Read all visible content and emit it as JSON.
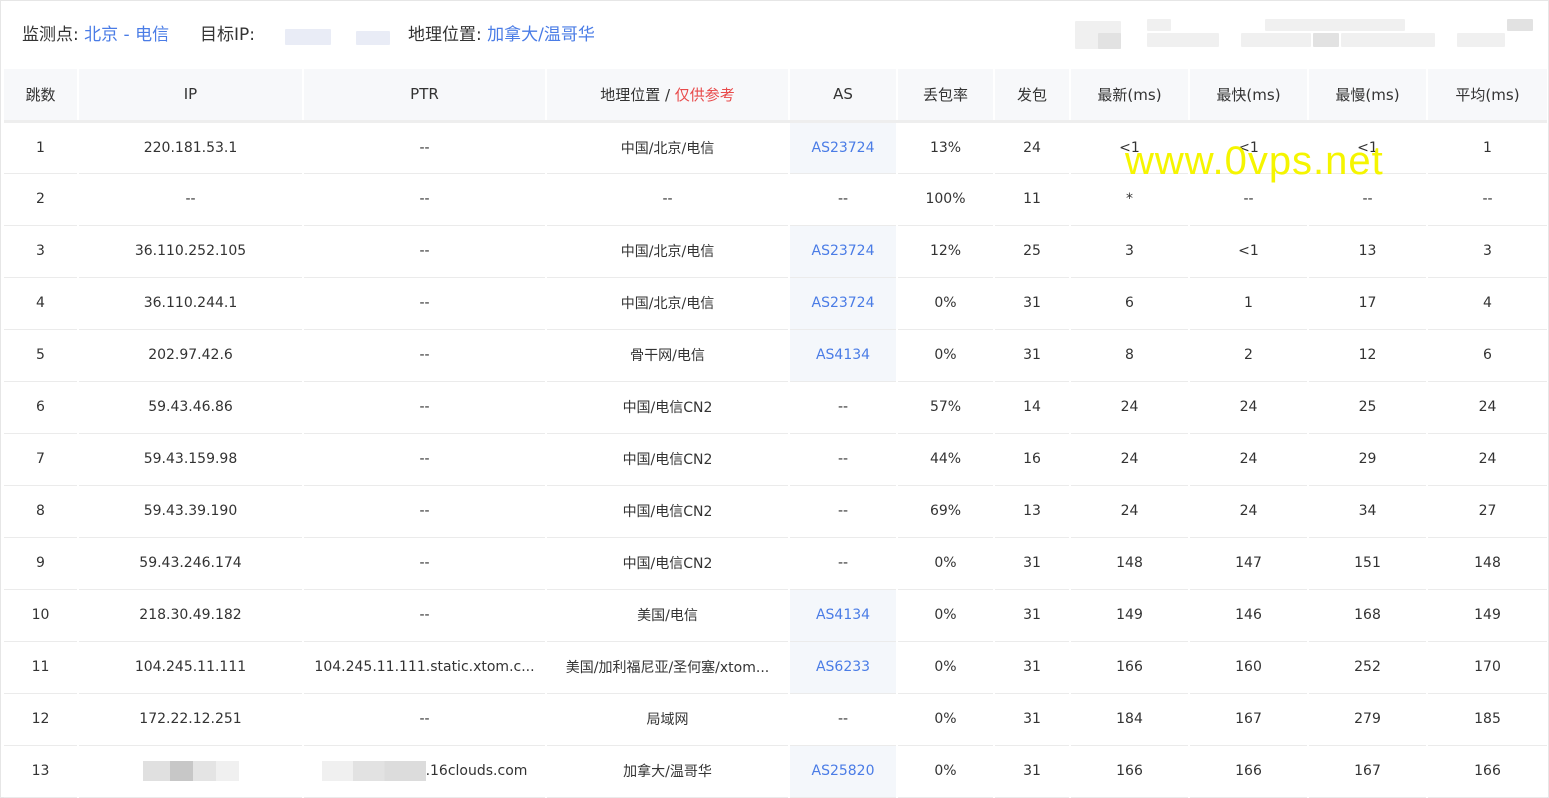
{
  "header": {
    "monitor_label": "监测点:",
    "monitor_value": "北京 - 电信",
    "target_label": "目标IP:",
    "geo_label": "地理位置:",
    "geo_value": "加拿大/温哥华"
  },
  "table": {
    "columns": [
      "跳数",
      "IP",
      "PTR",
      "地理位置",
      "AS",
      "丢包率",
      "发包",
      "最新(ms)",
      "最快(ms)",
      "最慢(ms)",
      "平均(ms)"
    ],
    "geo_sep": " / ",
    "geo_note": "仅供参考",
    "rows": [
      {
        "hop": "1",
        "ip": "220.181.53.1",
        "ptr": "--",
        "geo": "中国/北京/电信",
        "as": "AS23724",
        "loss": "13%",
        "sent": "24",
        "last": "<1",
        "best": "<1",
        "worst": "<1",
        "avg": "1"
      },
      {
        "hop": "2",
        "ip": "--",
        "ptr": "--",
        "geo": "--",
        "as": "--",
        "loss": "100%",
        "sent": "11",
        "last": "*",
        "best": "--",
        "worst": "--",
        "avg": "--"
      },
      {
        "hop": "3",
        "ip": "36.110.252.105",
        "ptr": "--",
        "geo": "中国/北京/电信",
        "as": "AS23724",
        "loss": "12%",
        "sent": "25",
        "last": "3",
        "best": "<1",
        "worst": "13",
        "avg": "3"
      },
      {
        "hop": "4",
        "ip": "36.110.244.1",
        "ptr": "--",
        "geo": "中国/北京/电信",
        "as": "AS23724",
        "loss": "0%",
        "sent": "31",
        "last": "6",
        "best": "1",
        "worst": "17",
        "avg": "4"
      },
      {
        "hop": "5",
        "ip": "202.97.42.6",
        "ptr": "--",
        "geo": "骨干网/电信",
        "as": "AS4134",
        "loss": "0%",
        "sent": "31",
        "last": "8",
        "best": "2",
        "worst": "12",
        "avg": "6"
      },
      {
        "hop": "6",
        "ip": "59.43.46.86",
        "ptr": "--",
        "geo": "中国/电信CN2",
        "as": "--",
        "loss": "57%",
        "sent": "14",
        "last": "24",
        "best": "24",
        "worst": "25",
        "avg": "24"
      },
      {
        "hop": "7",
        "ip": "59.43.159.98",
        "ptr": "--",
        "geo": "中国/电信CN2",
        "as": "--",
        "loss": "44%",
        "sent": "16",
        "last": "24",
        "best": "24",
        "worst": "29",
        "avg": "24"
      },
      {
        "hop": "8",
        "ip": "59.43.39.190",
        "ptr": "--",
        "geo": "中国/电信CN2",
        "as": "--",
        "loss": "69%",
        "sent": "13",
        "last": "24",
        "best": "24",
        "worst": "34",
        "avg": "27"
      },
      {
        "hop": "9",
        "ip": "59.43.246.174",
        "ptr": "--",
        "geo": "中国/电信CN2",
        "as": "--",
        "loss": "0%",
        "sent": "31",
        "last": "148",
        "best": "147",
        "worst": "151",
        "avg": "148"
      },
      {
        "hop": "10",
        "ip": "218.30.49.182",
        "ptr": "--",
        "geo": "美国/电信",
        "as": "AS4134",
        "loss": "0%",
        "sent": "31",
        "last": "149",
        "best": "146",
        "worst": "168",
        "avg": "149"
      },
      {
        "hop": "11",
        "ip": "104.245.11.111",
        "ptr": "104.245.11.111.static.xtom.c...",
        "geo": "美国/加利福尼亚/圣何塞/xtom...",
        "as": "AS6233",
        "loss": "0%",
        "sent": "31",
        "last": "166",
        "best": "160",
        "worst": "252",
        "avg": "170"
      },
      {
        "hop": "12",
        "ip": "172.22.12.251",
        "ptr": "--",
        "geo": "局域网",
        "as": "--",
        "loss": "0%",
        "sent": "31",
        "last": "184",
        "best": "167",
        "worst": "279",
        "avg": "185"
      },
      {
        "hop": "13",
        "ip": "",
        "ptr": ".16clouds.com",
        "geo": "加拿大/温哥华",
        "as": "AS25820",
        "loss": "0%",
        "sent": "31",
        "last": "166",
        "best": "166",
        "worst": "167",
        "avg": "166"
      }
    ]
  },
  "watermark": "www.0vps.net",
  "colors": {
    "link": "#4a7ce6",
    "note": "#e84a4a",
    "header_bg": "#f7f8fa",
    "as_cell_bg": "#f4f7fb",
    "watermark": "#f5f500"
  }
}
